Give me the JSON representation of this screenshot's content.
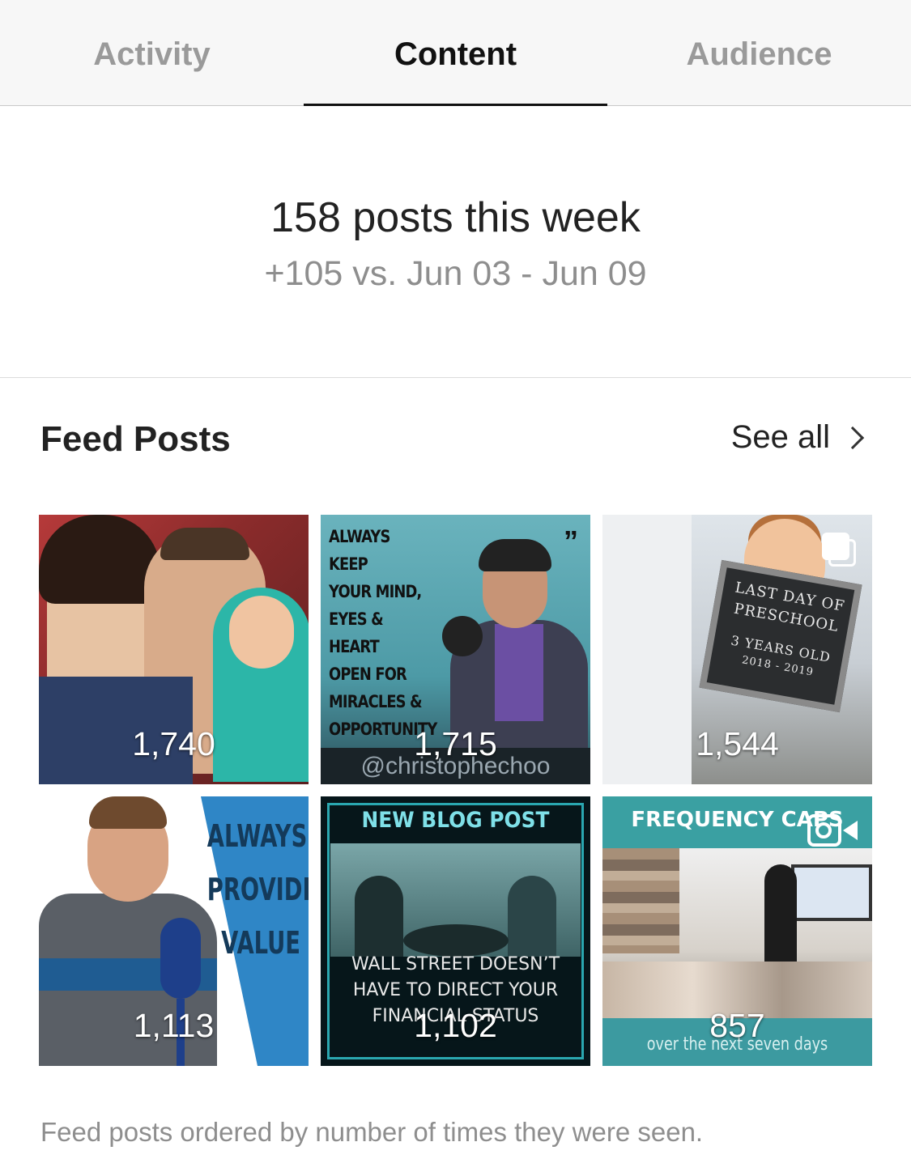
{
  "tabs": [
    {
      "label": "Activity",
      "active": false
    },
    {
      "label": "Content",
      "active": true
    },
    {
      "label": "Audience",
      "active": false
    }
  ],
  "summary": {
    "title": "158 posts this week",
    "subtitle": "+105 vs. Jun 03 - Jun 09"
  },
  "feed": {
    "title": "Feed Posts",
    "see_all": "See all",
    "posts": [
      {
        "count": "1,740",
        "type": "photo"
      },
      {
        "count": "1,715",
        "type": "photo",
        "overlay_lines": [
          "ALWAYS KEEP",
          "YOUR MIND,",
          "EYES & HEART",
          "OPEN FOR",
          "MIRACLES &",
          "OPPORTUNITY"
        ],
        "handle": "@christophechoo"
      },
      {
        "count": "1,544",
        "type": "carousel",
        "board_lines": [
          "LAST DAY OF",
          "PRESCHOOL",
          "3 YEARS OLD",
          "2018 - 2019"
        ]
      },
      {
        "count": "1,113",
        "type": "photo",
        "overlay_lines": [
          "ALWAYS",
          "PROVIDE",
          "VALUE"
        ]
      },
      {
        "count": "1,102",
        "type": "photo",
        "header": "NEW BLOG POST",
        "bottom_lines": [
          "WALL STREET DOESN’T",
          "HAVE TO DIRECT YOUR",
          "FINANCIAL STATUS"
        ]
      },
      {
        "count": "857",
        "type": "video",
        "header": "FREQUENCY CAPS",
        "bottom": "over the next seven days"
      }
    ]
  },
  "footnote": "Feed posts ordered by number of times they were seen."
}
